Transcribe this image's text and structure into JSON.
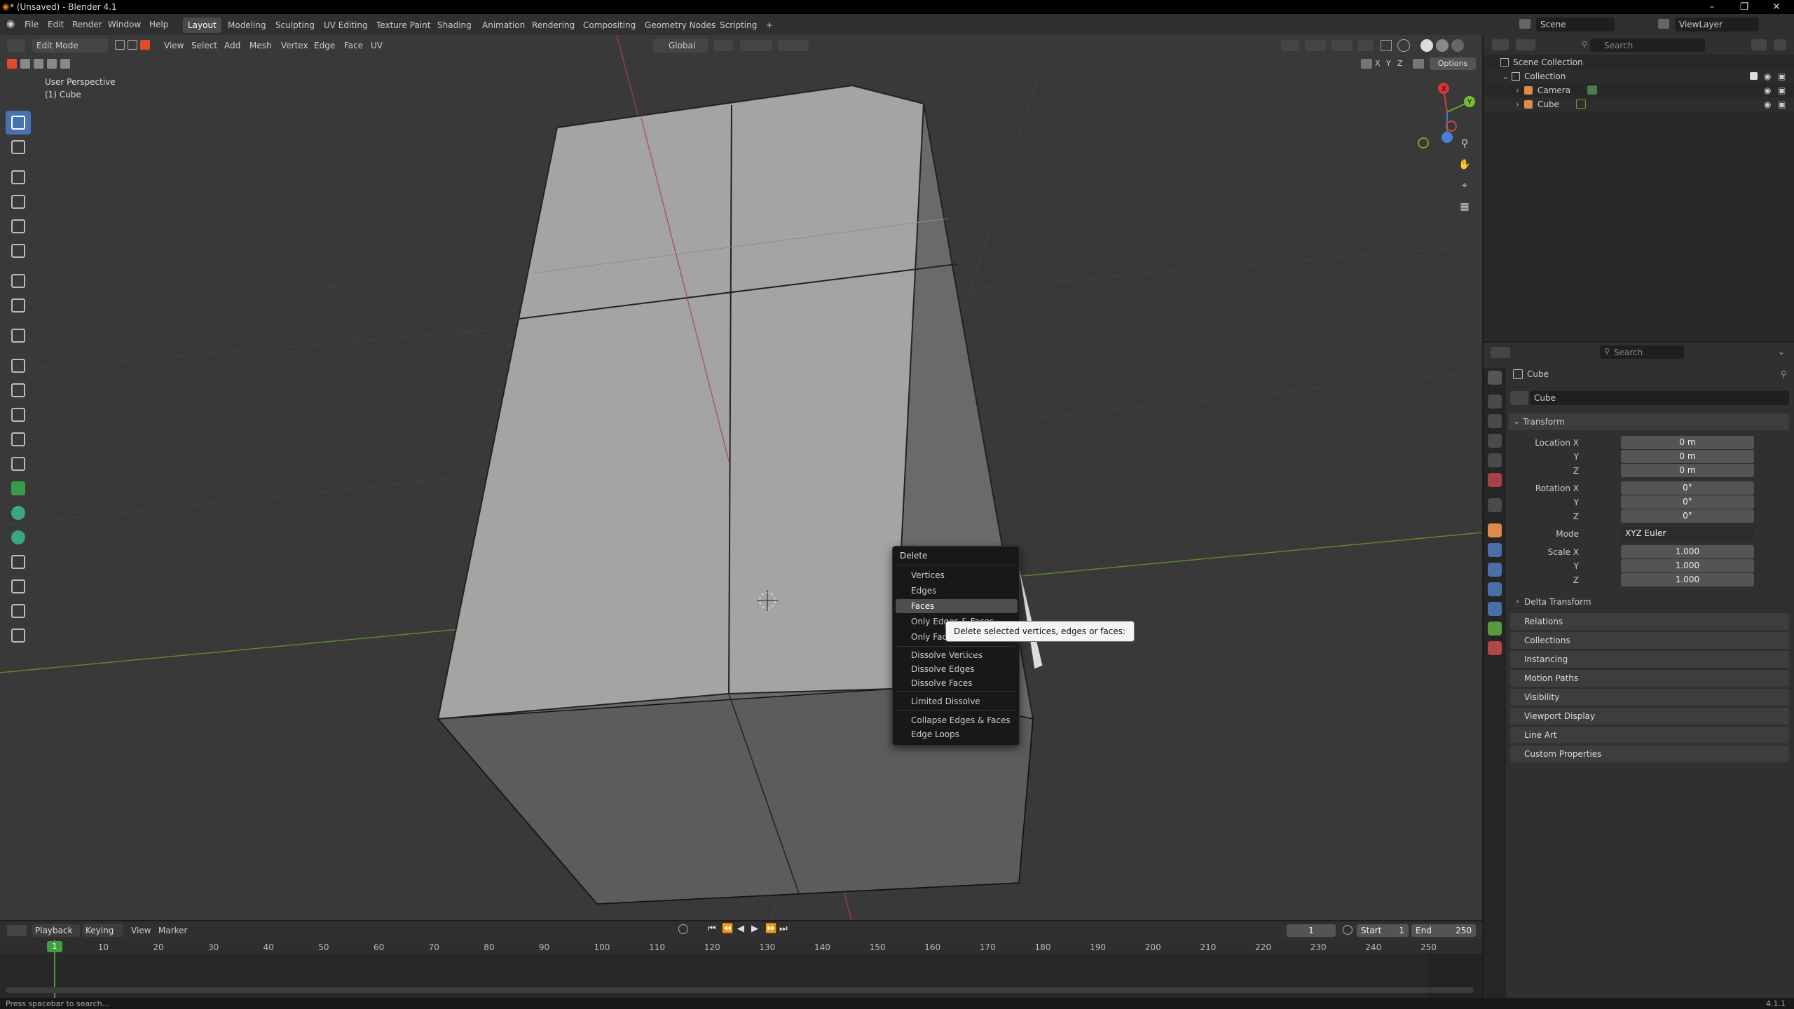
{
  "titlebar": {
    "title": "* (Unsaved) - Blender 4.1",
    "minimize": "–",
    "maximize": "❐",
    "close": "✕"
  },
  "menubar": {
    "items": [
      "File",
      "Edit",
      "Render",
      "Window",
      "Help"
    ]
  },
  "workspaces": [
    "Layout",
    "Modeling",
    "Sculpting",
    "UV Editing",
    "Texture Paint",
    "Shading",
    "Animation",
    "Rendering",
    "Compositing",
    "Geometry Nodes",
    "Scripting"
  ],
  "workspace_add": "+",
  "scene": {
    "label": "Scene",
    "viewlayer": "ViewLayer"
  },
  "viewport": {
    "mode": "Edit Mode",
    "menus": [
      "View",
      "Select",
      "Add",
      "Mesh",
      "Vertex",
      "Edge",
      "Face",
      "UV"
    ],
    "orientation": "Global",
    "options": "Options",
    "xyz": [
      "X",
      "Y",
      "Z"
    ],
    "overlay_title": "User Perspective",
    "overlay_object": "(1) Cube",
    "gizmo_axes": {
      "x": "X",
      "y": "Y",
      "z": "Z"
    }
  },
  "toolbar_icons": [
    "select-box-icon",
    "cursor-icon",
    "move-icon",
    "rotate-icon",
    "scale-icon",
    "transform-icon",
    "annotate-icon",
    "measure-icon",
    "add-cube-icon",
    "extrude-region-icon",
    "inset-faces-icon",
    "bevel-icon",
    "loop-cut-icon",
    "knife-icon",
    "poly-build-icon",
    "spin-icon",
    "smooth-icon",
    "edge-slide-icon",
    "shrink-fatten-icon",
    "shear-icon",
    "rip-region-icon"
  ],
  "context_menu": {
    "title": "Delete",
    "items": [
      "Vertices",
      "Edges",
      "Faces",
      "Only Edges & Faces",
      "Only Faces",
      "Dissolve Vertices",
      "Dissolve Edges",
      "Dissolve Faces",
      "Limited Dissolve",
      "Collapse Edges & Faces",
      "Edge Loops"
    ],
    "highlighted": "Faces"
  },
  "tooltip": {
    "text": "Delete selected vertices, edges or faces:",
    "value": "Faces"
  },
  "outliner": {
    "search_placeholder": "Search",
    "scene_collection": "Scene Collection",
    "collection": "Collection",
    "items": [
      "Camera",
      "Cube"
    ]
  },
  "properties": {
    "search_placeholder": "Search",
    "object_name": "Cube",
    "datablock_name": "Cube",
    "transform_label": "Transform",
    "location": {
      "label": "Location X",
      "x": "0 m",
      "y": "0 m",
      "z": "0 m"
    },
    "rotation": {
      "label": "Rotation X",
      "x": "0°",
      "y": "0°",
      "z": "0°"
    },
    "mode": {
      "label": "Mode",
      "value": "XYZ Euler"
    },
    "scale": {
      "label": "Scale X",
      "x": "1.000",
      "y": "1.000",
      "z": "1.000"
    },
    "axis_y": "Y",
    "axis_z": "Z",
    "delta_transform": "Delta Transform",
    "panels": [
      "Relations",
      "Collections",
      "Instancing",
      "Motion Paths",
      "Visibility",
      "Viewport Display",
      "Line Art",
      "Custom Properties"
    ]
  },
  "timeline": {
    "menus": [
      "Playback",
      "Keying",
      "View",
      "Marker"
    ],
    "current_frame": "1",
    "start_label": "Start",
    "start": "1",
    "end_label": "End",
    "end": "250",
    "frame_numbers": [
      "1",
      "10",
      "20",
      "30",
      "40",
      "50",
      "60",
      "70",
      "80",
      "90",
      "100",
      "110",
      "120",
      "130",
      "140",
      "150",
      "160",
      "170",
      "180",
      "190",
      "200",
      "210",
      "220",
      "230",
      "240",
      "250"
    ]
  },
  "statusbar": {
    "hint": "Press spacebar to search...",
    "version": "4.1.1"
  },
  "colors": {
    "accent": "#4772b3",
    "x_axis": "#b34b4b",
    "y_axis": "#6d9e2d",
    "playhead": "#3f9e3f"
  }
}
